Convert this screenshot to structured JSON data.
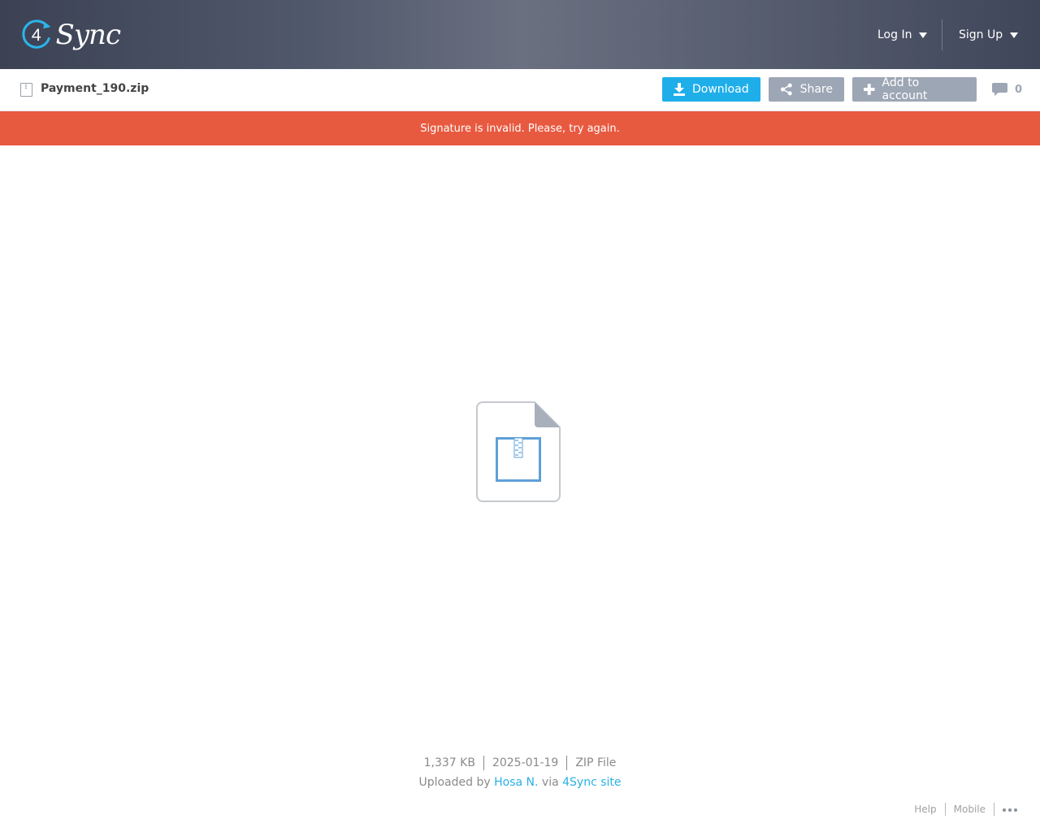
{
  "header": {
    "logo_text": "Sync",
    "logo_digit": "4",
    "login_label": "Log In",
    "signup_label": "Sign Up"
  },
  "toolbar": {
    "file_name": "Payment_190.zip",
    "download_label": "Download",
    "share_label": "Share",
    "add_label": "Add to account",
    "comments_count": "0"
  },
  "alert": {
    "message": "Signature is invalid. Please, try again."
  },
  "file": {
    "size": "1,337 KB",
    "date": "2025-01-19",
    "type": "ZIP File",
    "uploaded_prefix": "Uploaded by",
    "uploader": "Hosa N.",
    "via_word": "via",
    "source": "4Sync site"
  },
  "footer": {
    "help_label": "Help",
    "mobile_label": "Mobile"
  },
  "colors": {
    "accent": "#1eaeea",
    "alert": "#e85a40",
    "secondary_button": "#9da6b4",
    "link": "#2ab0e6"
  }
}
